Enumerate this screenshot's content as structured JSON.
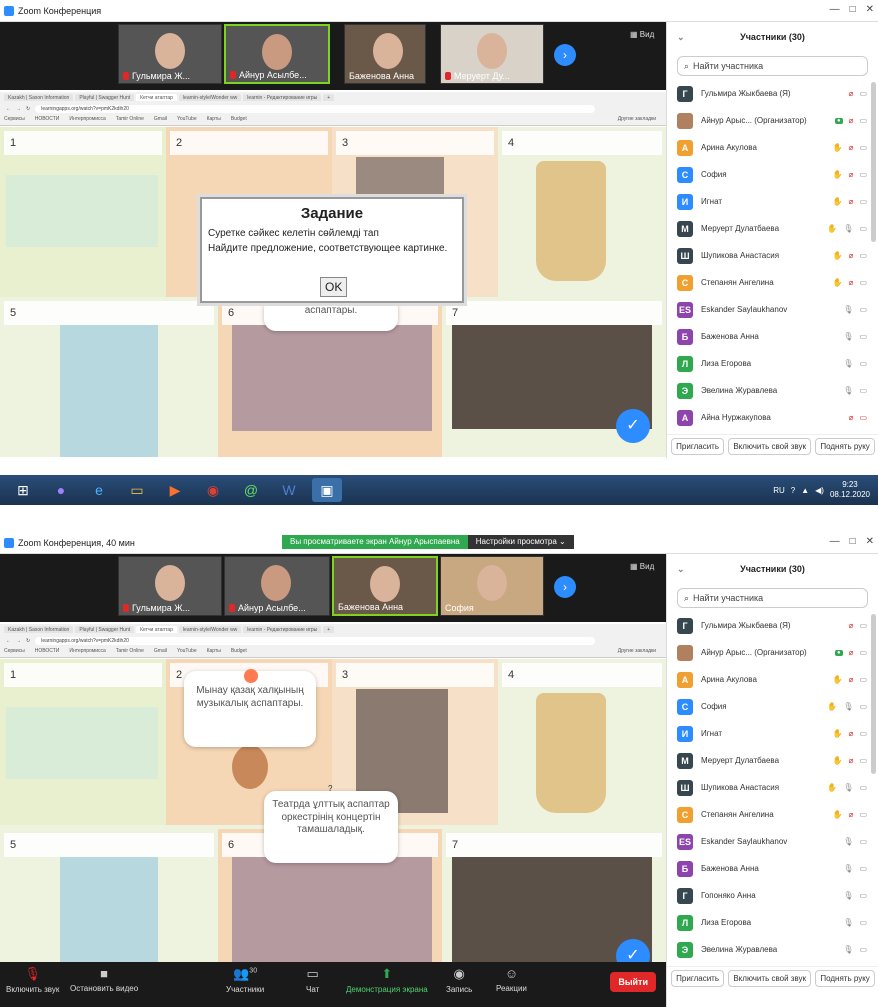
{
  "top": {
    "title": "Zoom Конференция",
    "view_label": "Вид",
    "thumbs": [
      {
        "name": "Гульмира Ж..."
      },
      {
        "name": "Айнур Асылбе..."
      },
      {
        "name": "Баженова Анна"
      },
      {
        "name": "Меруерт Ду..."
      }
    ],
    "browser": {
      "tabs": [
        "Kazakh | Saxon Information",
        "Playful | Swagger Hunt",
        "Кетчи атаптар",
        "learnin-style/Wonder ww",
        "learnin - Редактирование игры",
        "+"
      ],
      "url": "learningapps.org/watch?v=pmK2kdih20",
      "bookmarks": [
        "Сервисы",
        "НОВОСТИ",
        "Интерпромисса",
        "Tamir Online",
        "Gmail",
        "YouTube",
        "Карты",
        "Budget",
        "Другие закладки"
      ]
    },
    "cells": [
      {
        "num": "1"
      },
      {
        "num": "2"
      },
      {
        "num": "3"
      },
      {
        "num": "4"
      },
      {
        "num": "5"
      },
      {
        "num": "6"
      },
      {
        "num": "7"
      }
    ],
    "bubble_text": "аспаптары.",
    "dialog": {
      "title": "Задание",
      "line1": "Суретке сәйкес келетін сөйлемді тап",
      "line2": "Найдите предложение, соответствующее картинке.",
      "ok": "OK"
    },
    "panel": {
      "title": "Участники (30)",
      "search_placeholder": "Найти участника",
      "participants": [
        {
          "initial": "Г",
          "name": "Гульмира Жыкбаева (Я)",
          "color": "#37474f",
          "hand": false,
          "mic": "off",
          "cam": "on"
        },
        {
          "initial": "",
          "name": "Айнур Арыс... (Организатор)",
          "color": "#b08060",
          "hand": false,
          "mic": "off",
          "cam": "on",
          "rec": true
        },
        {
          "initial": "А",
          "name": "Арина Акулова",
          "color": "#f0a030",
          "hand": true,
          "mic": "off",
          "cam": "on"
        },
        {
          "initial": "С",
          "name": "София",
          "color": "#2d8cff",
          "hand": true,
          "mic": "off",
          "cam": "on"
        },
        {
          "initial": "И",
          "name": "Игнат",
          "color": "#2d8cff",
          "hand": true,
          "mic": "off",
          "cam": "on"
        },
        {
          "initial": "М",
          "name": "Меруерт Дулатбаева",
          "color": "#37474f",
          "hand": true,
          "mic": "on",
          "cam": "on"
        },
        {
          "initial": "Ш",
          "name": "Шупикова Анастасия",
          "color": "#37474f",
          "hand": true,
          "mic": "off",
          "cam": "on"
        },
        {
          "initial": "С",
          "name": "Степанян Ангелина",
          "color": "#f0a030",
          "hand": true,
          "mic": "off",
          "cam": "on"
        },
        {
          "initial": "ES",
          "name": "Eskander Saylaukhanov",
          "color": "#8e44ad",
          "hand": false,
          "mic": "on",
          "cam": "on"
        },
        {
          "initial": "Б",
          "name": "Баженова Анна",
          "color": "#8e44ad",
          "hand": false,
          "mic": "on",
          "cam": "on"
        },
        {
          "initial": "Л",
          "name": "Лиза Егорова",
          "color": "#2fa84f",
          "hand": false,
          "mic": "on",
          "cam": "on"
        },
        {
          "initial": "Э",
          "name": "Эвелина Журавлева",
          "color": "#2fa84f",
          "hand": false,
          "mic": "on",
          "cam": "on"
        },
        {
          "initial": "А",
          "name": "Айна Нуржакупова",
          "color": "#8e44ad",
          "hand": false,
          "mic": "off",
          "cam": "off"
        }
      ],
      "invite": "Пригласить",
      "unmute": "Включить свой звук",
      "raise": "Поднять руку"
    }
  },
  "taskbar": {
    "lang": "RU",
    "time": "9:23",
    "date": "08.12.2020"
  },
  "bottom": {
    "title": "Zoom Конференция, 40 мин",
    "share_notice": "Вы просматриваете экран Айнур Арыспаевна",
    "view_options": "Настройки просмотра",
    "view_label": "Вид",
    "thumbs": [
      {
        "name": "Гульмира Ж..."
      },
      {
        "name": "Айнур Асылбе..."
      },
      {
        "name": "Баженова Анна"
      },
      {
        "name": "София"
      }
    ],
    "cells": [
      {
        "num": "1"
      },
      {
        "num": "2"
      },
      {
        "num": "3"
      },
      {
        "num": "4"
      },
      {
        "num": "5"
      },
      {
        "num": "6"
      },
      {
        "num": "7"
      }
    ],
    "bubble1": "Мынау қазақ халқының музыкалық аспаптары.",
    "bubble2": "Театрда ұлттық аспаптар оркестрінің концертін тамашаладық.",
    "question_mark": "?",
    "panel": {
      "title": "Участники (30)",
      "search_placeholder": "Найти участника",
      "participants": [
        {
          "initial": "Г",
          "name": "Гульмира Жыкбаева (Я)",
          "color": "#37474f",
          "hand": false,
          "mic": "off",
          "cam": "on"
        },
        {
          "initial": "",
          "name": "Айнур Арыс... (Организатор)",
          "color": "#b08060",
          "hand": false,
          "mic": "off",
          "cam": "on",
          "rec": true
        },
        {
          "initial": "А",
          "name": "Арина Акулова",
          "color": "#f0a030",
          "hand": true,
          "mic": "off",
          "cam": "on"
        },
        {
          "initial": "С",
          "name": "София",
          "color": "#2d8cff",
          "hand": true,
          "mic": "on",
          "cam": "on"
        },
        {
          "initial": "И",
          "name": "Игнат",
          "color": "#2d8cff",
          "hand": true,
          "mic": "off",
          "cam": "on"
        },
        {
          "initial": "М",
          "name": "Меруерт Дулатбаева",
          "color": "#37474f",
          "hand": true,
          "mic": "off",
          "cam": "on"
        },
        {
          "initial": "Ш",
          "name": "Шупикова Анастасия",
          "color": "#37474f",
          "hand": true,
          "mic": "on",
          "cam": "on"
        },
        {
          "initial": "С",
          "name": "Степанян Ангелина",
          "color": "#f0a030",
          "hand": true,
          "mic": "off",
          "cam": "on"
        },
        {
          "initial": "ES",
          "name": "Eskander Saylaukhanov",
          "color": "#8e44ad",
          "hand": false,
          "mic": "on",
          "cam": "on"
        },
        {
          "initial": "Б",
          "name": "Баженова Анна",
          "color": "#8e44ad",
          "hand": false,
          "mic": "on",
          "cam": "on"
        },
        {
          "initial": "Г",
          "name": "Гопоняко Анна",
          "color": "#37474f",
          "hand": false,
          "mic": "on",
          "cam": "on"
        },
        {
          "initial": "Л",
          "name": "Лиза Егорова",
          "color": "#2fa84f",
          "hand": false,
          "mic": "on",
          "cam": "on"
        },
        {
          "initial": "Э",
          "name": "Эвелина Журавлева",
          "color": "#2fa84f",
          "hand": false,
          "mic": "on",
          "cam": "on"
        }
      ],
      "invite": "Пригласить",
      "unmute": "Включить свой звук",
      "raise": "Поднять руку"
    },
    "toolbar": {
      "unmute": "Включить звук",
      "video": "Остановить видео",
      "participants": "Участники",
      "participants_count": "30",
      "chat": "Чат",
      "share": "Демонстрация экрана",
      "record": "Запись",
      "reactions": "Реакции",
      "leave": "Выйти"
    }
  },
  "colors": {
    "zoom_blue": "#2d8cff",
    "accent_green": "#2fa84f",
    "danger_red": "#e02828"
  }
}
